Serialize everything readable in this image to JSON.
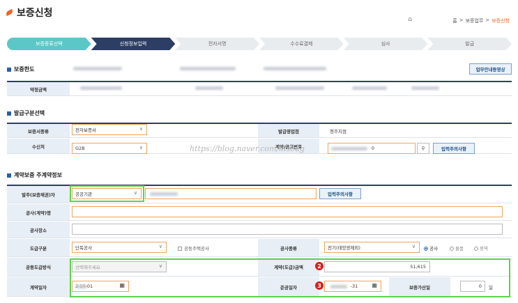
{
  "page": {
    "title": "보증신청"
  },
  "breadcrumb": {
    "home": "홈",
    "sep": ">",
    "mid": "보증업무",
    "current": "보증신청"
  },
  "steps": [
    "보증종류선택",
    "신청정보입력",
    "전자서명",
    "수수료결제",
    "심사",
    "발급"
  ],
  "sections": {
    "limit": "보증한도",
    "issue": "발급구분선택",
    "contract": "계약보증 주계약정보"
  },
  "limit": {
    "button": "업무안내동영상",
    "row_label": "약정금액"
  },
  "issue": {
    "type_label": "보증서종류",
    "type_value": "전자보증서",
    "branch_label": "발급영업점",
    "branch_value": "청주지점",
    "recipient_label": "수신처",
    "recipient_value": "G2B",
    "contract_no_label": "계약/공고번호",
    "contract_no_value": "0",
    "notice_button": "입력주의사항"
  },
  "contract": {
    "client_label": "발주(보증채권)자",
    "client_value": "공공기관",
    "client_notice": "입력주의사항",
    "name_label": "공사(계약)명",
    "place_label": "공사장소",
    "div_label": "도급구분",
    "div_value": "단독공사",
    "joint_label": "공동주택공사",
    "kind_label": "공사종류",
    "kind_value": "전기(태양광제외)",
    "radio": [
      "공사",
      "물품",
      "용역"
    ],
    "joint_method_label": "공동도급방식",
    "joint_method_placeholder": "선택해주세요",
    "amount_label": "계약(도급)금액",
    "amount_value": "51,615",
    "date_label": "계약일자",
    "date_value": "2         10-01",
    "done_label": "준공일자",
    "done_value": "-31",
    "extra_label": "보증가산일",
    "extra_value": "0",
    "extra_unit": "일"
  },
  "badges": {
    "two": "2",
    "three": "3"
  },
  "watermark": "https://blog.naver.com/klsoug",
  "icons": {
    "home": "home-icon",
    "calendar": "calendar-icon",
    "search": "search-icon"
  }
}
